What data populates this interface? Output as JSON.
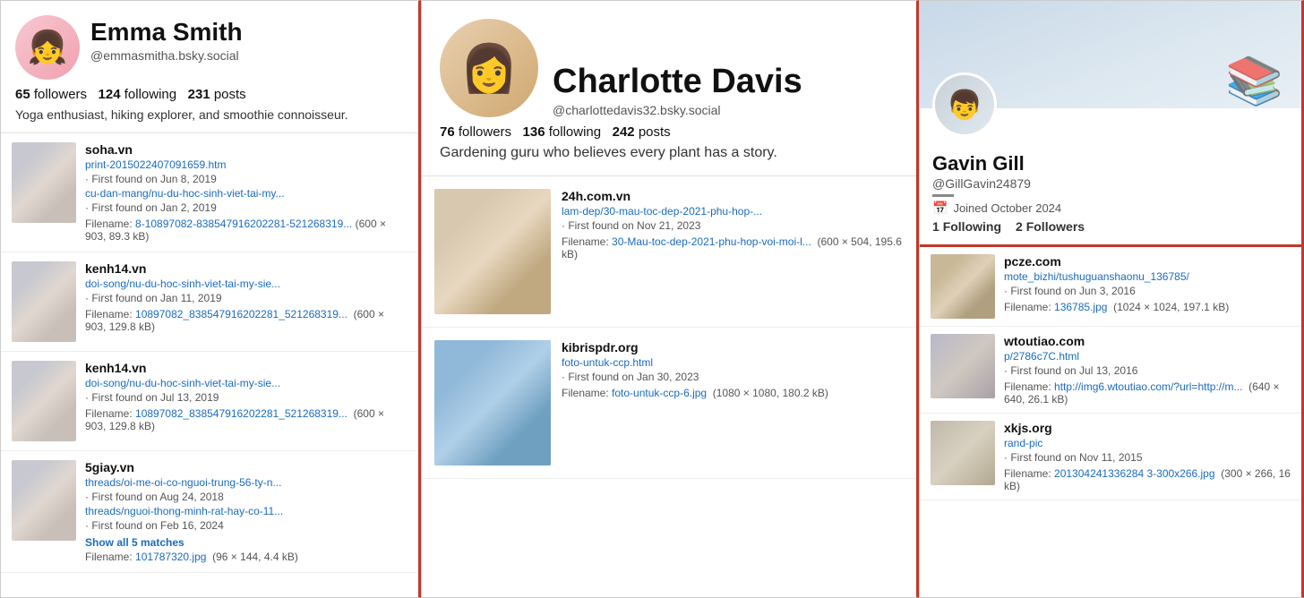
{
  "left": {
    "profile": {
      "name": "Emma Smith",
      "handle": "@emmasmitha.bsky.social",
      "followers": "65",
      "following": "124",
      "posts": "231",
      "bio": "Yoga enthusiast, hiking explorer, and smoothie connoisseur."
    },
    "results": [
      {
        "domain": "soha.vn",
        "link": "print-2015022407091659.htm",
        "found": "First found on Jun 8, 2019",
        "link2": "cu-dan-mang/nu-du-hoc-sinh-viet-tai-my...",
        "found2": "First found on Jan 2, 2019",
        "filename": "8-10897082-838547916202281-521268319...",
        "size": "(600 × 903, 89.3 kB)"
      },
      {
        "domain": "kenh14.vn",
        "link": "doi-song/nu-du-hoc-sinh-viet-tai-my-sie...",
        "found": "First found on Jan 11, 2019",
        "filename": "10897082_838547916202281_521268319...",
        "size": "(600 × 903, 129.8 kB)"
      },
      {
        "domain": "kenh14.vn",
        "link2": "doi-song/nu-du-hoc-sinh-viet-tai-my-sie...",
        "found2": "First found on Jul 13, 2019",
        "filename": "10897082_838547916202281_521268319...",
        "size": "(600 × 903, 129.8 kB)"
      },
      {
        "domain": "5giay.vn",
        "link": "threads/oi-me-oi-co-nguoi-trung-56-ty-n...",
        "found": "First found on Aug 24, 2018",
        "link2": "threads/nguoi-thong-minh-rat-hay-co-11...",
        "found2": "First found on Feb 16, 2024",
        "show_all": "Show all 5 matches",
        "filename": "101787320.jpg",
        "size": "(96 × 144, 4.4 kB)"
      }
    ]
  },
  "center": {
    "profile": {
      "name": "Charlotte Davis",
      "handle": "@charlottedavis32.bsky.social",
      "followers": "76",
      "following": "136",
      "posts": "242",
      "bio": "Gardening guru who believes every plant has a story."
    },
    "results": [
      {
        "domain": "24h.com.vn",
        "link": "lam-dep/30-mau-toc-dep-2021-phu-hop-...",
        "found": "First found on Nov 21, 2023",
        "filename": "30-Mau-toc-dep-2021-phu-hop-voi-moi-l...",
        "size": "(600 × 504, 195.6 kB)"
      },
      {
        "domain": "kibrispdr.org",
        "link": "foto-untuk-ccp.html",
        "found": "First found on Jan 30, 2023",
        "filename": "foto-untuk-ccp-6.jpg",
        "size": "(1080 × 1080, 180.2 kB)"
      }
    ]
  },
  "right": {
    "profile": {
      "name": "Gavin Gill",
      "handle": "@GillGavin24879",
      "joined": "Joined October 2024",
      "following": "1",
      "followers": "2",
      "following_label": "Following",
      "followers_label": "Followers"
    },
    "results": [
      {
        "domain": "pcze.com",
        "link": "mote_bizhi/tushuguanshaonu_136785/",
        "found": "First found on Jun 3, 2016",
        "filename": "136785.jpg",
        "size": "(1024 × 1024, 197.1 kB)"
      },
      {
        "domain": "wtoutiao.com",
        "link": "p/2786c7C.html",
        "found": "First found on Jul 13, 2016",
        "filename": "http://img6.wtoutiao.com/?url=http://m...",
        "size": "(640 × 640, 26.1 kB)"
      },
      {
        "domain": "xkjs.org",
        "link": "rand-pic",
        "found": "First found on Nov 11, 2015",
        "filename": "201304241336284 3-300x266.jpg",
        "size": "(300 × 266, 16 kB)"
      }
    ]
  },
  "labels": {
    "followers": "followers",
    "following": "following",
    "posts": "posts",
    "first_found": "First found on",
    "filename_label": "Filename:",
    "show_all": "Show all 5 matches"
  }
}
